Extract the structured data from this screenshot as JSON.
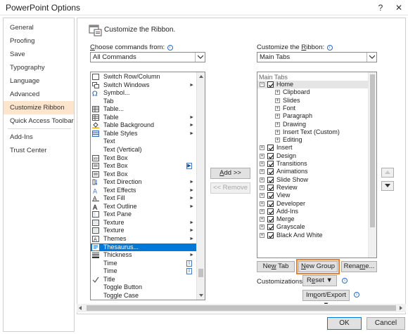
{
  "window": {
    "title": "PowerPoint Options",
    "help": "?",
    "close": "✕"
  },
  "nav": [
    {
      "label": "General"
    },
    {
      "label": "Proofing"
    },
    {
      "label": "Save"
    },
    {
      "label": "Typography"
    },
    {
      "label": "Language"
    },
    {
      "label": "Advanced"
    },
    {
      "label": "Customize Ribbon",
      "selected": true
    },
    {
      "label": "Quick Access Toolbar"
    },
    {
      "label": "Add-Ins"
    },
    {
      "label": "Trust Center"
    }
  ],
  "header": {
    "title": "Customize the Ribbon."
  },
  "left": {
    "label_prefix": "C",
    "label_rest": "hoose commands from:",
    "combo_value": "All Commands",
    "commands": [
      {
        "label": "Switch Row/Column",
        "icon": "switch-row-column-icon"
      },
      {
        "label": "Switch Windows",
        "icon": "switch-windows-icon",
        "sub": "►"
      },
      {
        "label": "Symbol...",
        "icon": "omega-icon"
      },
      {
        "label": "Tab",
        "icon": ""
      },
      {
        "label": "Table...",
        "icon": "table-icon"
      },
      {
        "label": "Table",
        "icon": "table-icon",
        "sub": "►"
      },
      {
        "label": "Table Background",
        "icon": "paint-bucket-icon",
        "sub": "►"
      },
      {
        "label": "Table Styles",
        "icon": "table-styles-icon",
        "sub": "►"
      },
      {
        "label": "Text",
        "icon": ""
      },
      {
        "label": "Text (Vertical)",
        "icon": ""
      },
      {
        "label": "Text Box",
        "icon": "abl-icon"
      },
      {
        "label": "Text Box",
        "icon": "text-box-icon",
        "bar": "▶"
      },
      {
        "label": "Text Box",
        "icon": "text-box-icon"
      },
      {
        "label": "Text Direction",
        "icon": "text-direction-icon",
        "sub": "►"
      },
      {
        "label": "Text Effects",
        "icon": "text-effects-icon",
        "sub": "►"
      },
      {
        "label": "Text Fill",
        "icon": "text-fill-icon",
        "sub": "►"
      },
      {
        "label": "Text Outline",
        "icon": "text-outline-icon",
        "sub": "►"
      },
      {
        "label": "Text Pane",
        "icon": "text-pane-icon"
      },
      {
        "label": "Texture",
        "icon": "texture-icon",
        "sub": "►"
      },
      {
        "label": "Texture",
        "icon": "texture-icon",
        "sub": "►"
      },
      {
        "label": "Themes",
        "icon": "themes-icon",
        "sub": "►"
      },
      {
        "label": "Thesaurus...",
        "icon": "thesaurus-icon",
        "selected": true
      },
      {
        "label": "Thickness",
        "icon": "thickness-icon",
        "sub": "►"
      },
      {
        "label": "Time",
        "icon": "",
        "bar": "I"
      },
      {
        "label": "Time",
        "icon": "",
        "bar": "I"
      },
      {
        "label": "Title",
        "icon": "checkmark-icon"
      },
      {
        "label": "Toggle Button",
        "icon": ""
      },
      {
        "label": "Toggle Case",
        "icon": ""
      }
    ]
  },
  "middle": {
    "add_label": "Add >>",
    "remove_label": "<< Remove"
  },
  "right": {
    "label_prefix": "Customize the ",
    "label_u": "R",
    "label_rest": "ibbon:",
    "combo_value": "Main Tabs",
    "tree_header": "Main Tabs",
    "home": {
      "label": "Home"
    },
    "home_groups": [
      "Clipboard",
      "Slides",
      "Font",
      "Paragraph",
      "Drawing",
      "Insert Text (Custom)",
      "Editing"
    ],
    "tabs": [
      "Insert",
      "Design",
      "Transitions",
      "Animations",
      "Slide Show",
      "Review",
      "View",
      "Developer",
      "Add-Ins",
      "Merge",
      "Grayscale",
      "Black And White"
    ],
    "new_tab": "New Tab",
    "new_group": "New Group",
    "rename": "Rename...",
    "customizations_label": "Customizations:",
    "reset": "Reset",
    "import_export": "Import/Export"
  },
  "footer": {
    "ok": "OK",
    "cancel": "Cancel"
  },
  "colors": {
    "accent": "#0078d7",
    "highlight": "#ed7d31",
    "nav_selected": "#fde4cc"
  }
}
